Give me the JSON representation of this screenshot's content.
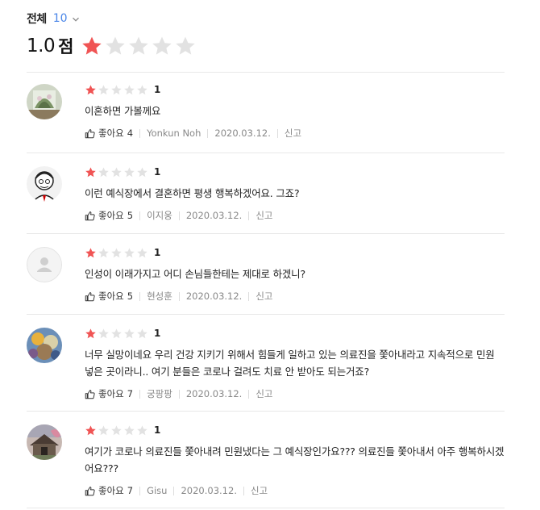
{
  "filter": {
    "label": "전체",
    "count": "10"
  },
  "summary": {
    "score": "1.0",
    "unit": "점",
    "rating": 1,
    "max": 5
  },
  "colors": {
    "star_on": "#f05454",
    "star_off": "#e2e2e2",
    "accent": "#4a86e8"
  },
  "reviews": [
    {
      "rating": 1,
      "star_label": "1",
      "text": "이혼하면 가볼께요",
      "like_label": "좋아요",
      "likes": "4",
      "author": "Yonkun Noh",
      "date": "2020.03.12.",
      "report": "신고"
    },
    {
      "rating": 1,
      "star_label": "1",
      "text": "이런 예식장에서 결혼하면 평생 행복하겠어요. 그죠?",
      "like_label": "좋아요",
      "likes": "5",
      "author": "이지웅",
      "date": "2020.03.12.",
      "report": "신고"
    },
    {
      "rating": 1,
      "star_label": "1",
      "text": "인성이 이래가지고 어디 손님들한테는 제대로 하겠니?",
      "like_label": "좋아요",
      "likes": "5",
      "author": "현성훈",
      "date": "2020.03.12.",
      "report": "신고"
    },
    {
      "rating": 1,
      "star_label": "1",
      "text": "너무 실망이네요 우리 건강 지키기 위해서 힘들게 일하고 있는 의료진을 쫓아내라고 지속적으로 민원 넣은 곳이라니.. 여기 분들은 코로나 걸려도 치료 안 받아도 되는거죠?",
      "like_label": "좋아요",
      "likes": "7",
      "author": "궁팡팡",
      "date": "2020.03.12.",
      "report": "신고"
    },
    {
      "rating": 1,
      "star_label": "1",
      "text": "여기가 코로나 의료진들 쫓아내려 민원냈다는 그 예식장인가요??? 의료진들 쫓아내서 아주 행복하시겠어요???",
      "like_label": "좋아요",
      "likes": "7",
      "author": "Gisu",
      "date": "2020.03.12.",
      "report": "신고"
    }
  ]
}
